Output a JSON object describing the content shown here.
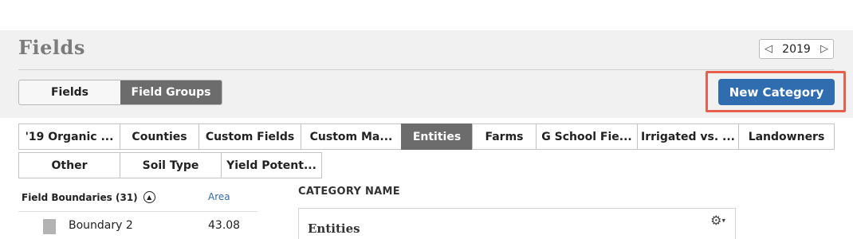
{
  "page": {
    "title": "Fields"
  },
  "year_selector": {
    "prev_icon": "◁",
    "value": "2019",
    "next_icon": "▷"
  },
  "view_toggle": [
    {
      "label": "Fields",
      "active": false
    },
    {
      "label": "Field Groups",
      "active": true
    }
  ],
  "actions": {
    "new_category_label": "New Category",
    "accent": "#2f6db0",
    "highlight_color": "#e8604c"
  },
  "category_tabs": {
    "row1": [
      {
        "label": "'19 Organic ...",
        "active": false
      },
      {
        "label": "Counties",
        "active": false
      },
      {
        "label": "Custom Fields",
        "active": false
      },
      {
        "label": "Custom Ma...",
        "active": false
      },
      {
        "label": "Entities",
        "active": true
      },
      {
        "label": "Farms",
        "active": false
      },
      {
        "label": "G School Fie...",
        "active": false
      },
      {
        "label": "Irrigated vs. ...",
        "active": false
      },
      {
        "label": "Landowners",
        "active": false
      }
    ],
    "row2": [
      {
        "label": "Other",
        "active": false
      },
      {
        "label": "Soil Type",
        "active": false
      },
      {
        "label": "Yield Potent...",
        "active": false
      }
    ]
  },
  "field_boundaries": {
    "header": "Field Boundaries (31)",
    "sort_icon": "sort-ascending-icon",
    "area_header": "Area",
    "rows": [
      {
        "name": "Boundary 2",
        "area": "43.08"
      }
    ]
  },
  "category_panel": {
    "column_header": "CATEGORY NAME",
    "name": "Entities",
    "gear_icon": "gear-icon"
  }
}
